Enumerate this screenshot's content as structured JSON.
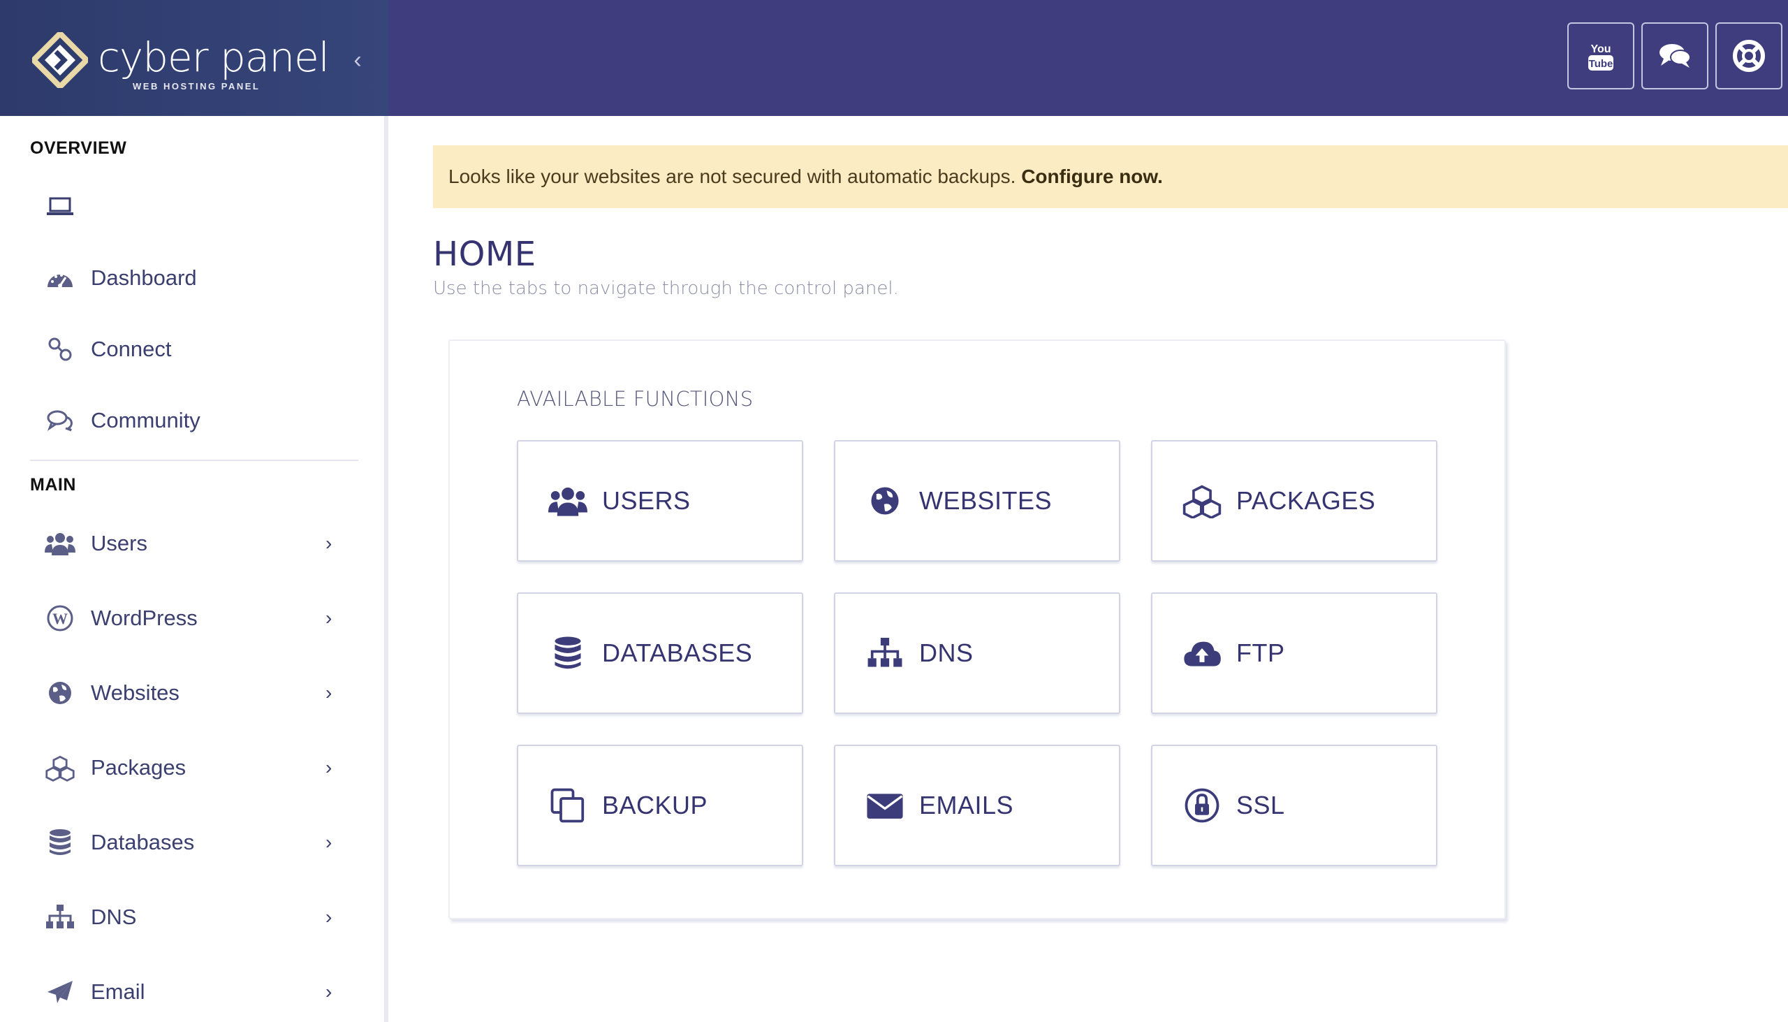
{
  "header": {
    "logo_text": "cyber panel",
    "logo_sub": "WEB HOSTING PANEL",
    "collapse_glyph": "‹",
    "buttons": [
      {
        "name": "youtube-icon",
        "label": "YouTube"
      },
      {
        "name": "chat-icon",
        "label": "Community chat"
      },
      {
        "name": "support-icon",
        "label": "Support"
      }
    ]
  },
  "sidebar": {
    "overview_title": "OVERVIEW",
    "main_title": "MAIN",
    "overview_items": [
      {
        "label": "",
        "icon": "laptop-icon"
      },
      {
        "label": "Dashboard",
        "icon": "dashboard-icon"
      },
      {
        "label": "Connect",
        "icon": "link-icon"
      },
      {
        "label": "Community",
        "icon": "comments-icon"
      }
    ],
    "main_items": [
      {
        "label": "Users",
        "icon": "users-icon"
      },
      {
        "label": "WordPress",
        "icon": "wordpress-icon"
      },
      {
        "label": "Websites",
        "icon": "globe-icon"
      },
      {
        "label": "Packages",
        "icon": "cubes-icon"
      },
      {
        "label": "Databases",
        "icon": "database-icon"
      },
      {
        "label": "DNS",
        "icon": "sitemap-icon"
      },
      {
        "label": "Email",
        "icon": "paper-plane-icon"
      }
    ],
    "chevron": "›"
  },
  "alert": {
    "text": "Looks like your websites are not secured with automatic backups. ",
    "link": "Configure now."
  },
  "page": {
    "title": "HOME",
    "subtitle": "Use the tabs to navigate through the control panel."
  },
  "functions": {
    "title": "AVAILABLE FUNCTIONS",
    "tiles": [
      {
        "label": "USERS",
        "icon": "users-icon"
      },
      {
        "label": "WEBSITES",
        "icon": "globe-icon"
      },
      {
        "label": "PACKAGES",
        "icon": "cubes-icon"
      },
      {
        "label": "DATABASES",
        "icon": "database-icon"
      },
      {
        "label": "DNS",
        "icon": "sitemap-icon"
      },
      {
        "label": "FTP",
        "icon": "cloud-upload-icon"
      },
      {
        "label": "BACKUP",
        "icon": "copy-icon"
      },
      {
        "label": "EMAILS",
        "icon": "envelope-icon"
      },
      {
        "label": "SSL",
        "icon": "lock-icon"
      }
    ]
  },
  "colors": {
    "header_bg": "#3f3d7e",
    "accent": "#353470",
    "alert_bg": "#fcecc4"
  }
}
